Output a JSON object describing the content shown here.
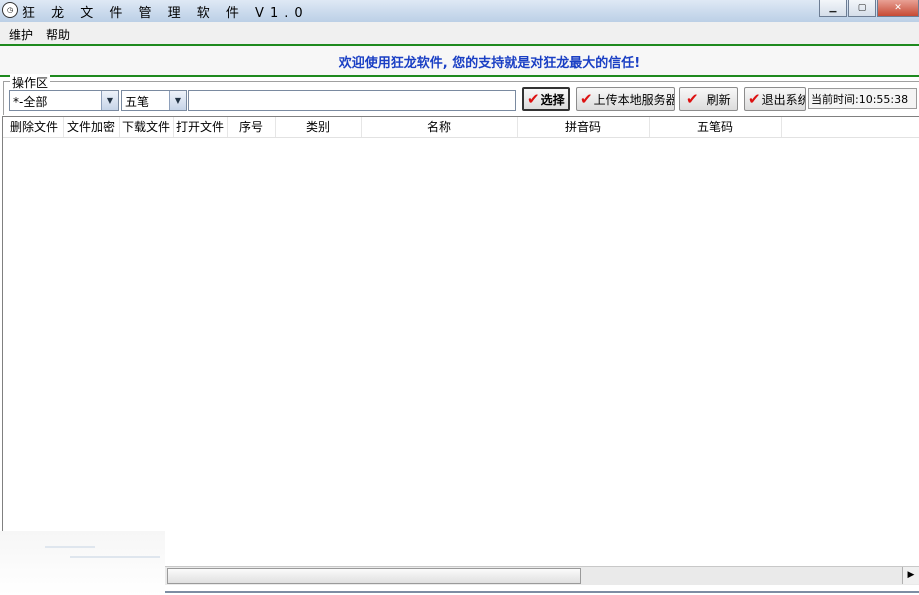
{
  "window": {
    "title": "狂 龙 文 件 管 理 软 件 V1.0",
    "icon": "app-clock-icon",
    "controls": {
      "minimize": "▁",
      "maximize": "▢",
      "close": "✕"
    }
  },
  "menu": {
    "items": [
      "维护",
      "帮助"
    ]
  },
  "banner": {
    "text": "欢迎使用狂龙软件, 您的支持就是对狂龙最大的信任!",
    "color": "#1a3fc4"
  },
  "operation_area": {
    "legend": "操作区",
    "category_select": {
      "value": "*-全部"
    },
    "input_method_select": {
      "value": "五笔"
    },
    "search_input": {
      "value": "",
      "placeholder": ""
    },
    "buttons": {
      "select": "选择",
      "upload": "上传本地服务器",
      "refresh": "刷新",
      "exit": "退出系统"
    },
    "clock": {
      "label": "当前时间:",
      "time": "10:55:38"
    }
  },
  "grid": {
    "columns": [
      "删除文件",
      "文件加密",
      "下载文件",
      "打开文件",
      "序号",
      "类别",
      "名称",
      "拼音码",
      "五笔码"
    ],
    "rows": []
  },
  "scrollbar": {
    "right_arrow": "▶"
  }
}
